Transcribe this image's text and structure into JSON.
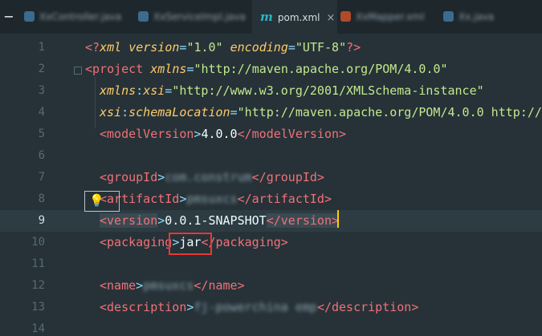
{
  "tabs": [
    {
      "label": "XxController.java",
      "icon_color": "#3b6b8f",
      "active": false
    },
    {
      "label": "XxServiceImpl.java",
      "icon_color": "#3b6b8f",
      "active": false
    },
    {
      "label": "pom.xml",
      "icon_name": "maven-m-icon",
      "active": true
    },
    {
      "label": "XxMapper.xml",
      "icon_color": "#b04a2a",
      "active": false
    },
    {
      "label": "Xx.java",
      "icon_color": "#3b6b8f",
      "active": false
    }
  ],
  "tab_close_glyph": "×",
  "line_numbers": [
    "1",
    "2",
    "3",
    "4",
    "5",
    "6",
    "7",
    "8",
    "9",
    "10",
    "11",
    "12",
    "13",
    "14"
  ],
  "lines": {
    "l1": {
      "pi_open": "<?",
      "xml": "xml",
      "version_attr": "version",
      "eq": "=",
      "version_val": "\"1.0\"",
      "encoding_attr": "encoding",
      "encoding_val": "\"UTF-8\"",
      "pi_close": "?>"
    },
    "l2": {
      "open": "<project",
      "ns": "xmlns",
      "eq": "=",
      "val": "\"http://maven.apache.org/POM/4.0.0\""
    },
    "l3": {
      "ns": "xmlns",
      "colon": ":",
      "local": "xsi",
      "eq": "=",
      "val": "\"http://www.w3.org/2001/XMLSchema-instance\""
    },
    "l4": {
      "ns": "xsi",
      "colon": ":",
      "local": "schemaLocation",
      "eq": "=",
      "val": "\"http://maven.apache.org/POM/4.0.0 http://m"
    },
    "l5": {
      "open": "<modelVersion",
      "gt": ">",
      "text": "4.0.0",
      "close": "</modelVersion>"
    },
    "l7": {
      "open": "<groupId",
      "gt": ">",
      "text": "com.construm",
      "close": "</groupId>"
    },
    "l8": {
      "open": "<artifactId",
      "gt": ">",
      "text": "pmsuxcs",
      "close": "</artifactId>"
    },
    "l9": {
      "open": "<version",
      "gt": ">",
      "text": "0.0.1-SNAPSHOT",
      "close": "</version>"
    },
    "l10": {
      "open": "<packaging",
      "gt": ">",
      "text": "jar",
      "close": "</packaging>"
    },
    "l12": {
      "open": "<name",
      "gt": ">",
      "text": "pmsuxcs",
      "close": "</name>"
    },
    "l13": {
      "open": "<description",
      "gt": ">",
      "text": "fj-powerchina emp",
      "close": "</description>"
    }
  },
  "bulb_glyph": "💡",
  "minus_glyph": "−"
}
